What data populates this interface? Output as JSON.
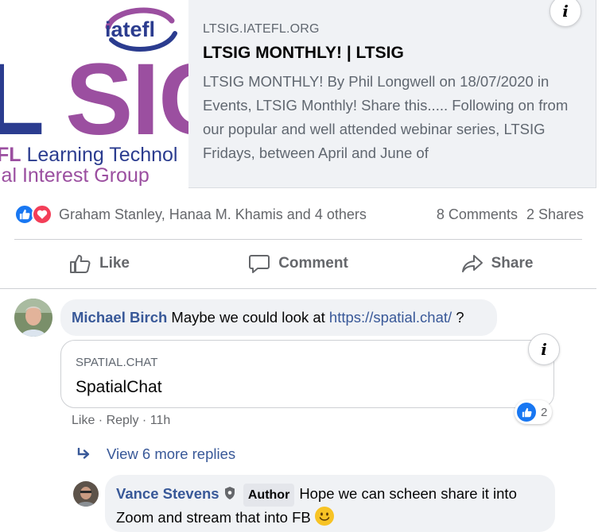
{
  "preview": {
    "thumbnail": {
      "logo_text": "iatefl",
      "big_l": "L",
      "big_sig": "SIG",
      "line1_bold": "FL",
      "line1_rest": " Learning Technol",
      "line2": "ial Interest Group"
    },
    "domain": "LTSIG.IATEFL.ORG",
    "title": "LTSIG MONTHLY! | LTSIG",
    "description": "LTSIG MONTHLY! By Phil Longwell on 18/07/2020 in Events, LTSIG Monthly! Share this..... Following on from our popular and well attended webinar series, LTSIG Fridays, between April and June of",
    "info_glyph": "i"
  },
  "reactions": {
    "reactors": "Graham Stanley, Hanaa M. Khamis and 4 others",
    "comments": "8 Comments",
    "shares": "2 Shares"
  },
  "actions": {
    "like": "Like",
    "comment": "Comment",
    "share": "Share"
  },
  "comment1": {
    "author": "Michael Birch",
    "text_before": " Maybe we could look at ",
    "link": "https://spatial.chat/",
    "text_after": " ?",
    "card": {
      "domain": "SPATIAL.CHAT",
      "title": "SpatialChat",
      "info_glyph": "i"
    },
    "meta": {
      "like": "Like",
      "sep1": " · ",
      "reply": "Reply",
      "sep2": " · ",
      "time": "11h"
    },
    "reaction_count": "2"
  },
  "replies": {
    "view_more": "View 6 more replies"
  },
  "comment2": {
    "author": "Vance Stevens",
    "badge": "Author",
    "text": "Hope we can scheen share it into Zoom and stream that into FB"
  },
  "colors": {
    "link_blue": "#385898",
    "like_blue": "#1877f2",
    "love_red": "#f33e58",
    "iatefl_blue": "#2b3c8f",
    "iatefl_purple": "#9b4fa0"
  }
}
